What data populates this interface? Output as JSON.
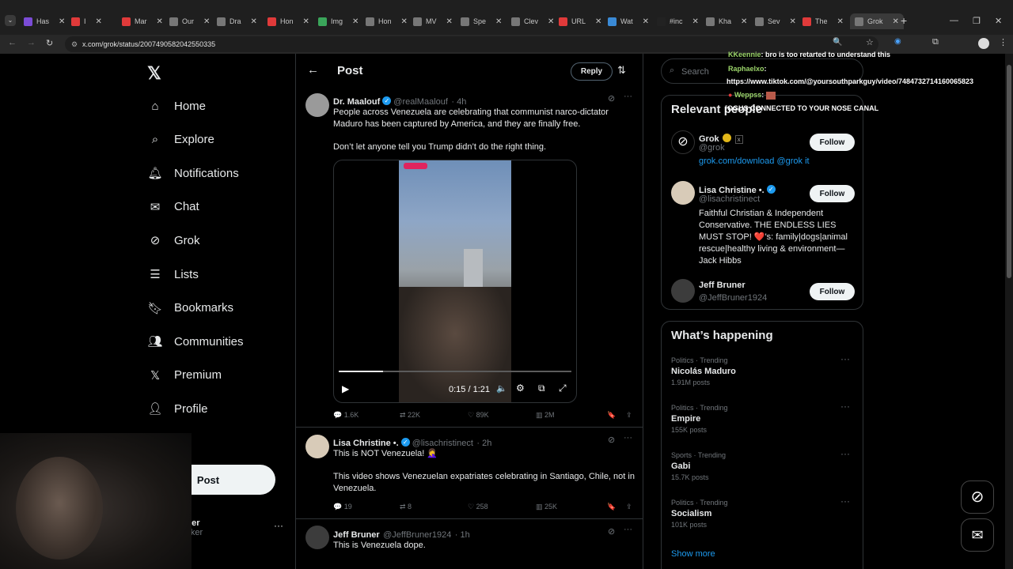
{
  "browser": {
    "tabs": [
      {
        "label": "Has",
        "color": "#7b4cd6"
      },
      {
        "label": "I",
        "color": "#e03a3a"
      },
      {
        "label": "Mar",
        "color": "#e03a3a"
      },
      {
        "label": "Our",
        "color": "#777"
      },
      {
        "label": "Dra",
        "color": "#777"
      },
      {
        "label": "Hon",
        "color": "#e03a3a"
      },
      {
        "label": "Img",
        "color": "#3aa55a"
      },
      {
        "label": "Hon",
        "color": "#777"
      },
      {
        "label": "MV",
        "color": "#777"
      },
      {
        "label": "Spe",
        "color": "#777"
      },
      {
        "label": "Clev",
        "color": "#777"
      },
      {
        "label": "URL",
        "color": "#e03a3a"
      },
      {
        "label": "Wat",
        "color": "#3a8ad6"
      },
      {
        "label": "#inc",
        "color": "#222"
      },
      {
        "label": "Kha",
        "color": "#777"
      },
      {
        "label": "Sev",
        "color": "#777"
      },
      {
        "label": "The",
        "color": "#e03a3a"
      },
      {
        "label": "Grok",
        "color": "#777"
      }
    ],
    "url": "x.com/grok/status/2007490582042550335"
  },
  "nav": {
    "items": [
      {
        "label": "Home",
        "icon": "home-icon"
      },
      {
        "label": "Explore",
        "icon": "search-icon"
      },
      {
        "label": "Notifications",
        "icon": "bell-icon"
      },
      {
        "label": "Chat",
        "icon": "mail-icon"
      },
      {
        "label": "Grok",
        "icon": "grok-icon"
      },
      {
        "label": "Lists",
        "icon": "list-icon"
      },
      {
        "label": "Bookmarks",
        "icon": "bookmark-icon"
      },
      {
        "label": "Communities",
        "icon": "people-icon"
      },
      {
        "label": "Premium",
        "icon": "x-icon"
      },
      {
        "label": "Profile",
        "icon": "person-icon"
      },
      {
        "label": "re",
        "icon": "more-icon"
      }
    ],
    "post_label": "Post",
    "account_name": "ker",
    "account_handle": "iiker"
  },
  "header": {
    "title": "Post",
    "reply_label": "Reply"
  },
  "main_post": {
    "name": "Dr. Maalouf",
    "handle": "@realMaalouf",
    "time": "· 4h",
    "text1": "People across Venezuela are celebrating that communist narco-dictator Maduro has been captured by America, and they are finally free.",
    "text2": "Don’t let anyone tell you Trump didn’t do the right thing.",
    "video_time": "0:15 / 1:21",
    "video_progress": 0.19,
    "replies": "1.6K",
    "reposts": "22K",
    "likes": "89K",
    "views": "2M"
  },
  "reply1": {
    "name": "Lisa Christine •.",
    "handle": "@lisachristinect",
    "time": "· 2h",
    "text1": "This is NOT Venezuela! 🤦‍♀️",
    "text2": "This video shows Venezuelan expatriates celebrating in Santiago, Chile, not in Venezuela.",
    "replies": "19",
    "reposts": "8",
    "likes": "258",
    "views": "25K"
  },
  "reply2": {
    "name": "Jeff Bruner",
    "handle": "@JeffBruner1924",
    "time": "· 1h",
    "text": "This is Venezuela dope."
  },
  "search": {
    "placeholder": "Search"
  },
  "relevant": {
    "title": "Relevant people",
    "people": [
      {
        "name": "Grok",
        "handle": "@grok",
        "bio": "grok.com/download @grok it",
        "follow": "Follow"
      },
      {
        "name": "Lisa Christine •.",
        "handle": "@lisachristinect",
        "bio": "Faithful Christian & Independent Conservative. THE ENDLESS LIES MUST STOP! ❤️'s: family|dogs|animal rescue|healthy living & environment—Jack Hibbs",
        "follow": "Follow"
      },
      {
        "name": "Jeff Bruner",
        "handle": "@JeffBruner1924",
        "bio": "",
        "follow": "Follow"
      }
    ]
  },
  "trends": {
    "title": "What’s happening",
    "items": [
      {
        "meta": "Politics · Trending",
        "name": "Nicolás Maduro",
        "count": "1.91M posts"
      },
      {
        "meta": "Politics · Trending",
        "name": "Empire",
        "count": "155K posts"
      },
      {
        "meta": "Sports · Trending",
        "name": "Gabi",
        "count": "15.7K posts"
      },
      {
        "meta": "Politics · Trending",
        "name": "Socialism",
        "count": "101K posts"
      }
    ],
    "show_more": "Show more"
  },
  "chat_overlay": {
    "line1_user": "KKeennie",
    "line1_msg": ": bro is too retarted to understand this",
    "line2_user": "Raphaelxo",
    "line2_msg": ":",
    "line3": "https://www.tiktok.com/@yoursouthparkguy/video/7484732714160065823",
    "line4_user": "Weppss",
    "line4_msg": ":",
    "line5": "[OGUS CONNECTED TO YOUR NOSE CANAL"
  }
}
